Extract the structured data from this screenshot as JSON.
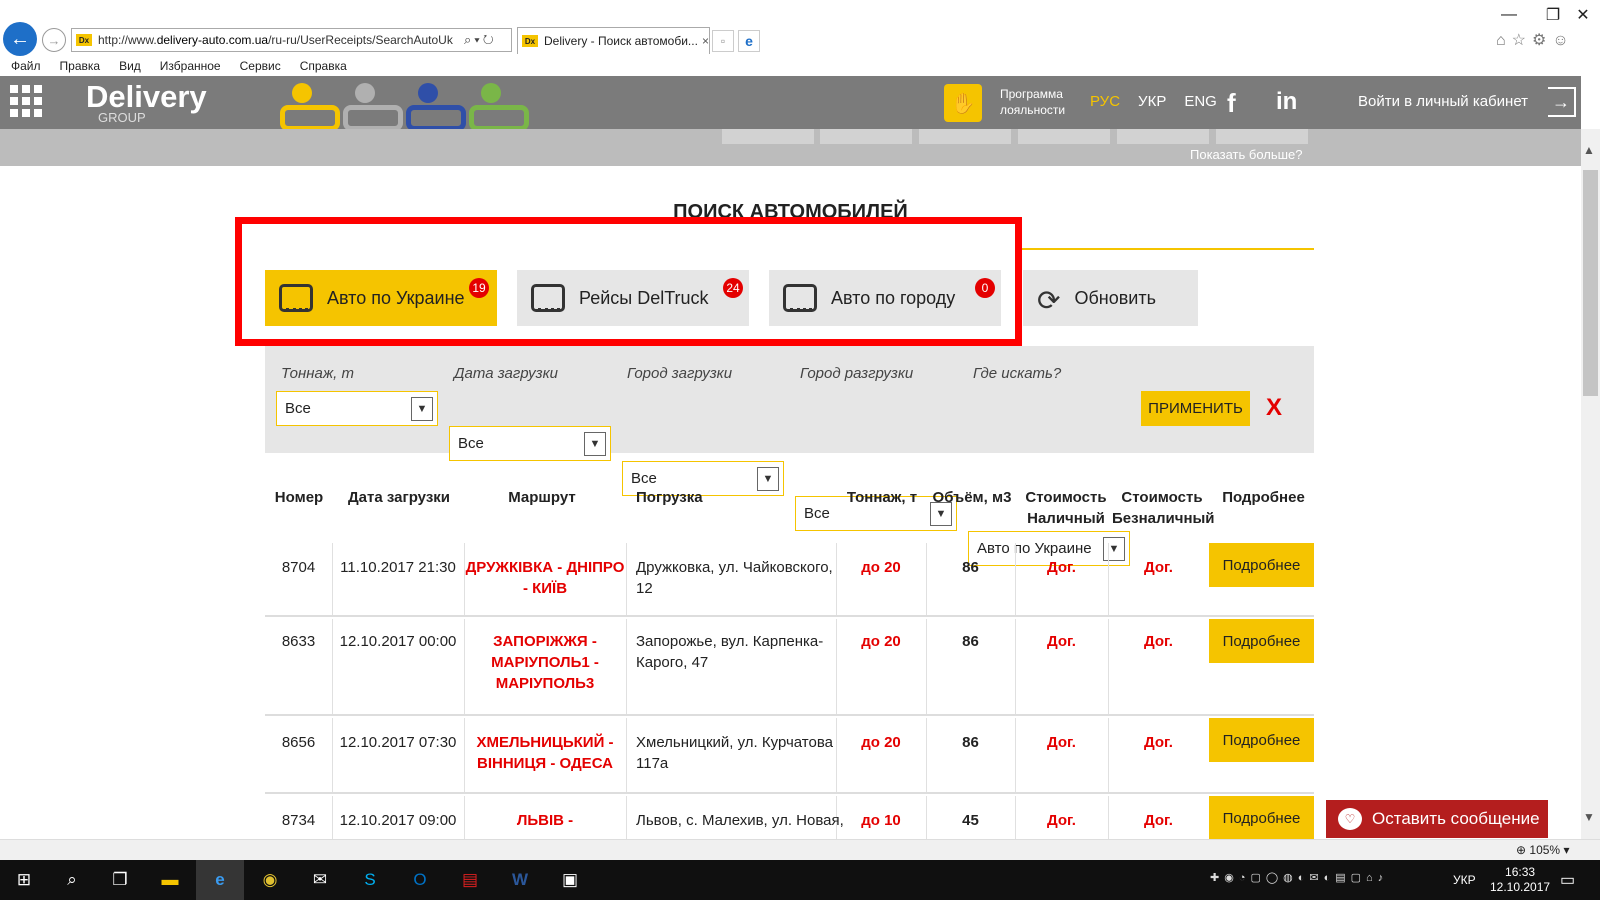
{
  "browser": {
    "url_prefix": "http://www.",
    "url_domain": "delivery-auto.com.ua",
    "url_path": "/ru-ru/UserReceipts/SearchAutoUk",
    "tab_title": "Delivery - Поиск автомоби...",
    "favicon_text": "Dx",
    "menu": [
      "Файл",
      "Правка",
      "Вид",
      "Избранное",
      "Сервис",
      "Справка"
    ],
    "zoom": "105%"
  },
  "site": {
    "logo_main": "Delivery",
    "logo_sub": "GROUP",
    "banner_colors": [
      "#f5c400",
      "#b0b0b0",
      "#2f4fa8",
      "#7ab648"
    ],
    "loyalty_line1": "Программа",
    "loyalty_line2": "лояльности",
    "languages": [
      "РУС",
      "УКР",
      "ENG"
    ],
    "active_language": "РУС",
    "facebook": "f",
    "linkedin": "in",
    "login": "Войти в личный кабинет",
    "show_more": "Показать больше?"
  },
  "page": {
    "title": "ПОИСК АВТОМОБИЛЕЙ",
    "filter_tabs": [
      {
        "label": "Авто по Украине",
        "count": "19"
      },
      {
        "label": "Рейсы DelTruck",
        "count": "24"
      },
      {
        "label": "Авто по городу",
        "count": "0"
      }
    ],
    "refresh_label": "Обновить",
    "filters": [
      {
        "label": "Тоннаж, т",
        "value": "Все"
      },
      {
        "label": "Дата загрузки",
        "value": "Все"
      },
      {
        "label": "Город загрузки",
        "value": "Все"
      },
      {
        "label": "Город разгрузки",
        "value": "Все"
      },
      {
        "label": "Где искать?",
        "value": "Авто по Украине"
      }
    ],
    "apply_label": "ПРИМЕНИТЬ",
    "clear_label": "X"
  },
  "table": {
    "headers": [
      "Номер",
      "Дата загрузки",
      "Маршрут",
      "Погрузка",
      "Тоннаж, т",
      "Объём, м3",
      "Стоимость Наличный",
      "Стоимость Безналичный",
      "Подробнее"
    ],
    "rows": [
      {
        "number": "8704",
        "date": "11.10.2017 21:30",
        "route": "ДРУЖКІВКА - ДНІПРО - КИЇВ",
        "loading": "Дружковка, ул. Чайковского, 12",
        "tonnage": "до 20",
        "volume": "86",
        "cash": "Дог.",
        "cashless": "Дог.",
        "detail": "Подробнее"
      },
      {
        "number": "8633",
        "date": "12.10.2017 00:00",
        "route": "ЗАПОРІЖЖЯ - МАРІУПОЛЬ1 - МАРІУПОЛЬ3",
        "loading": "Запорожье, вул. Карпенка-Карого, 47",
        "tonnage": "до 20",
        "volume": "86",
        "cash": "Дог.",
        "cashless": "Дог.",
        "detail": "Подробнее"
      },
      {
        "number": "8656",
        "date": "12.10.2017 07:30",
        "route": "ХМЕЛЬНИЦЬКИЙ - ВІННИЦЯ - ОДЕСА",
        "loading": "Хмельницкий, ул. Курчатова 117а",
        "tonnage": "до 20",
        "volume": "86",
        "cash": "Дог.",
        "cashless": "Дог.",
        "detail": "Подробнее"
      },
      {
        "number": "8734",
        "date": "12.10.2017 09:00",
        "route": "ЛЬВІВ -",
        "loading": "Львов, с. Малехив, ул. Новая,",
        "tonnage": "до 10",
        "volume": "45",
        "cash": "Дог.",
        "cashless": "Дог.",
        "detail": "Подробнее"
      }
    ]
  },
  "chat": {
    "label": "Оставить сообщение"
  },
  "taskbar": {
    "language": "УКР",
    "time": "16:33",
    "date": "12.10.2017"
  }
}
